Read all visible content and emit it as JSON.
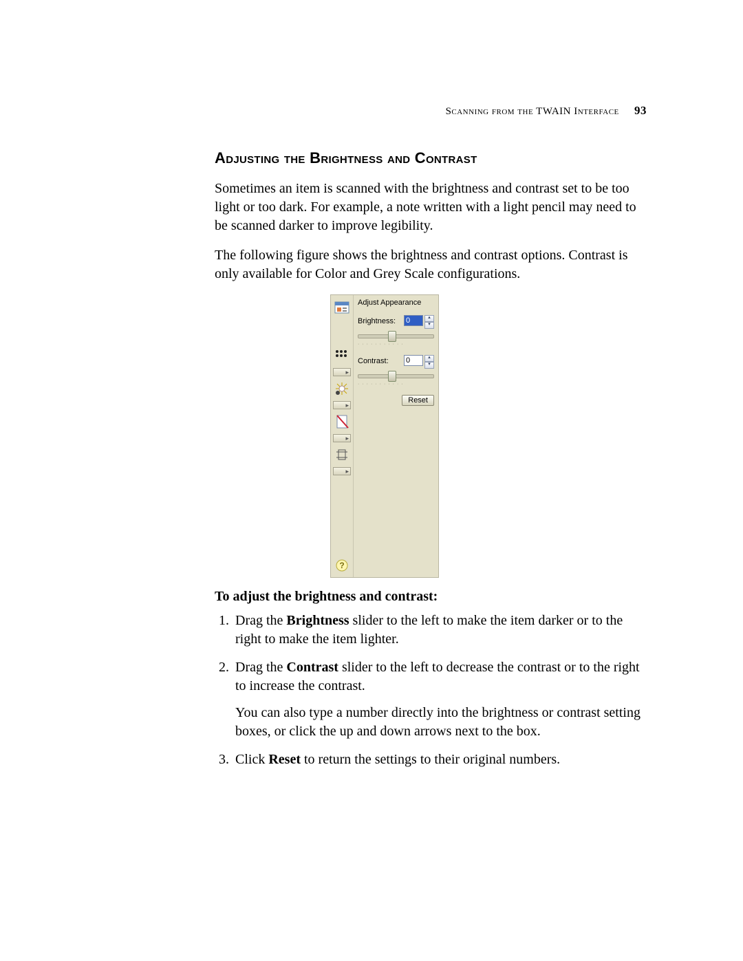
{
  "header": {
    "chapter": "Scanning from the TWAIN Interface",
    "page_number": "93"
  },
  "title": "Adjusting the Brightness and Contrast",
  "paragraph1": "Sometimes an item is scanned with the brightness and contrast set to be too light or too dark. For example, a note written with a light pencil may need to be scanned darker to improve legibility.",
  "paragraph2": "The following figure shows the brightness and contrast options. Contrast is only available for Color and Grey Scale configurations.",
  "panel": {
    "heading": "Adjust Appearance",
    "brightness_label": "Brightness:",
    "brightness_value": "0",
    "contrast_label": "Contrast:",
    "contrast_value": "0",
    "reset_label": "Reset"
  },
  "procedure_heading": "To adjust the brightness and contrast:",
  "steps": {
    "s1a": "Drag the ",
    "s1b": "Brightness",
    "s1c": " slider to the left to make the item darker or to the right to make the item lighter.",
    "s2a": "Drag the ",
    "s2b": "Contrast",
    "s2c": " slider to the left to decrease the contrast or to the right to increase the contrast.",
    "s2extra": "You can also type a number directly into the brightness or contrast setting boxes, or click the up and down arrows next to the box.",
    "s3a": "Click ",
    "s3b": "Reset",
    "s3c": " to return the settings to their original numbers."
  }
}
